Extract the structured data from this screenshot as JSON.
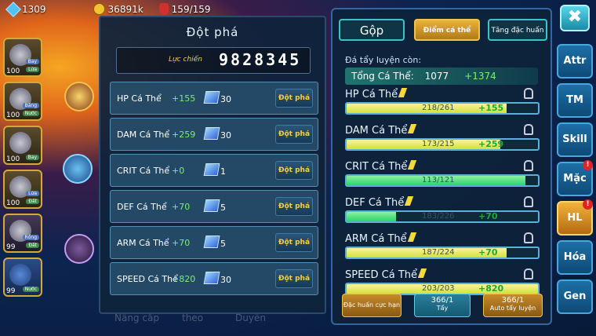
{
  "topbar": {
    "gems": "1309",
    "gold": "36891k",
    "potion": "159/159"
  },
  "party": [
    {
      "level": "100",
      "tag1": "Bay",
      "tag2": "Lửa"
    },
    {
      "level": "100",
      "tag1": "Băng",
      "tag2": "Nước"
    },
    {
      "level": "100",
      "tag1": "",
      "tag2": "Bay"
    },
    {
      "level": "100",
      "tag1": "Lửa",
      "tag2": "Đất"
    },
    {
      "level": "99",
      "tag1": "Rồng",
      "tag2": "Đất"
    },
    {
      "level": "99",
      "tag1": "",
      "tag2": "Nước"
    }
  ],
  "breakthrough": {
    "title": "Đột phá",
    "power_label": "Lực chiến",
    "power_value": "9828345",
    "rows": [
      {
        "name": "HP Cá Thể",
        "bonus": "+155",
        "count": "30",
        "button": "Đột phá"
      },
      {
        "name": "DAM Cá Thể",
        "bonus": "+259",
        "count": "30",
        "button": "Đột phá"
      },
      {
        "name": "CRIT Cá Thể",
        "bonus": "+0",
        "count": "1",
        "button": "Đột phá"
      },
      {
        "name": "DEF Cá Thể",
        "bonus": "+70",
        "count": "5",
        "button": "Đột phá"
      },
      {
        "name": "ARM Cá Thể",
        "bonus": "+70",
        "count": "5",
        "button": "Đột phá"
      },
      {
        "name": "SPEED Cá Thể",
        "bonus": "+820",
        "count": "30",
        "button": "Đột phá"
      }
    ]
  },
  "faded_bottom": [
    "Nâng cấp",
    "theo",
    "Duyên"
  ],
  "training": {
    "tabs": [
      "Gộp",
      "Điểm cá thể",
      "Tăng đặc huấn"
    ],
    "remaining_label": "Đá tẩy luyện còn:",
    "total_label": "Tổng Cá Thể:",
    "total_value": "1077",
    "total_bonus": "+1374",
    "stats": [
      {
        "name": "HP Cá Thể",
        "value": "218/261",
        "bonus": "+155",
        "fill": 0.835,
        "color": "yellow"
      },
      {
        "name": "DAM Cá Thể",
        "value": "173/215",
        "bonus": "+259",
        "fill": 0.805,
        "color": "yellow"
      },
      {
        "name": "CRIT Cá Thể",
        "value": "113/121",
        "bonus": "",
        "fill": 0.934,
        "color": "green"
      },
      {
        "name": "DEF Cá Thể",
        "value": "183/226",
        "bonus": "+70",
        "fill": 0.26,
        "color": "green"
      },
      {
        "name": "ARM Cá Thể",
        "value": "187/224",
        "bonus": "+70",
        "fill": 0.835,
        "color": "yellow"
      },
      {
        "name": "SPEED Cá Thể",
        "value": "203/203",
        "bonus": "+820",
        "fill": 1.0,
        "color": "yellow"
      }
    ],
    "bottom_buttons": {
      "special": "Đặc huấn cực hạn",
      "wash_count": "366/1",
      "wash_label": "Tẩy",
      "auto_count": "366/1",
      "auto_label": "Auto tẩy luyện"
    }
  },
  "side_tabs": [
    {
      "label": "Attr",
      "badge": ""
    },
    {
      "label": "TM",
      "badge": ""
    },
    {
      "label": "Skill",
      "badge": ""
    },
    {
      "label": "Mặc",
      "badge": "!"
    },
    {
      "label": "HL",
      "badge": "!",
      "active": true
    },
    {
      "label": "Hóa",
      "badge": ""
    },
    {
      "label": "Gen",
      "badge": ""
    }
  ],
  "close_glyph": "✖"
}
